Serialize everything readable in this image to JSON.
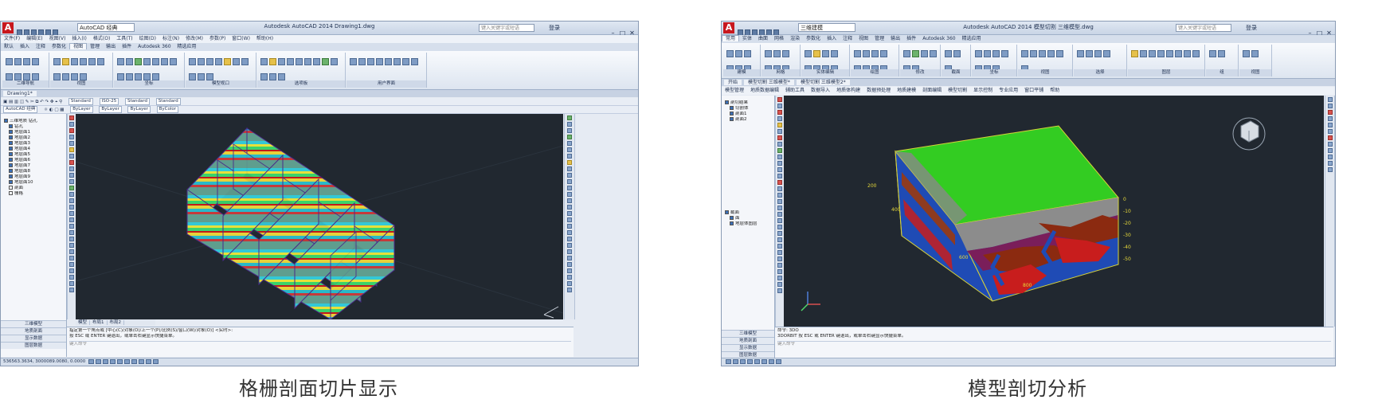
{
  "left": {
    "title": "Autodesk AutoCAD 2014  Drawing1.dwg",
    "workspace": "AutoCAD 经典",
    "search_placeholder": "键入关键字或短语",
    "login": "登录",
    "menus": [
      "文件(F)",
      "编辑(E)",
      "视图(V)",
      "插入(I)",
      "格式(O)",
      "工具(T)",
      "绘图(D)",
      "标注(N)",
      "修改(M)",
      "参数(P)",
      "窗口(W)",
      "帮助(H)"
    ],
    "ribbon_tabs": [
      "默认",
      "插入",
      "注释",
      "参数化",
      "视图",
      "管理",
      "输出",
      "插件",
      "Autodesk 360",
      "精选应用"
    ],
    "active_tab": "视图",
    "panels": [
      "二维导航",
      "视图",
      "坐标",
      "模型视口",
      "选项板",
      "用户界面"
    ],
    "doc_tab": "Drawing1*",
    "toolbar_styles": [
      "Standard",
      "ISO-25",
      "Standard",
      "Standard"
    ],
    "layer_bar": [
      "AutoCAD 经典",
      "ByLayer",
      "ByLayer",
      "ByLayer",
      "ByColor"
    ],
    "tree": [
      {
        "label": "三维地质 钻孔",
        "checked": true
      },
      {
        "label": "钻孔",
        "checked": true
      },
      {
        "label": "地层面1",
        "checked": true
      },
      {
        "label": "地层面2",
        "checked": true
      },
      {
        "label": "地层面3",
        "checked": true
      },
      {
        "label": "地层面4",
        "checked": true
      },
      {
        "label": "地层面5",
        "checked": true
      },
      {
        "label": "地层面6",
        "checked": true
      },
      {
        "label": "地层面7",
        "checked": true
      },
      {
        "label": "地层面8",
        "checked": true
      },
      {
        "label": "地层面9",
        "checked": true
      },
      {
        "label": "地层面10",
        "checked": true
      },
      {
        "label": "剖面",
        "checked": false
      },
      {
        "label": "栅格",
        "checked": false
      }
    ],
    "side_buttons": [
      "三维模型",
      "地质剖面",
      "显示数据",
      "图层数据"
    ],
    "layout_tabs": [
      "模型",
      "布局1",
      "布局2"
    ],
    "cmd_lines": [
      "指定第一个角点或 [中心(C)/对象(O)/上一个(P)/比例(S)/窗口(W)/对象(O)] <实时>:",
      "按 ESC 或 ENTER 键退出，或单击右键显示快捷菜单。"
    ],
    "cmd_prompt": "键入命令",
    "coords": "536563.3634, 3000089.0080, 0.0000",
    "caption": "格栅剖面切片显示"
  },
  "right": {
    "title": "Autodesk AutoCAD 2014  模型切割 三维模型.dwg",
    "workspace": "三维建模",
    "search_placeholder": "键入关键字或短语",
    "login": "登录",
    "ribbon_tabs": [
      "常用",
      "实体",
      "曲面",
      "网格",
      "渲染",
      "参数化",
      "插入",
      "注释",
      "视图",
      "管理",
      "输出",
      "插件",
      "Autodesk 360",
      "精选应用"
    ],
    "active_tab": "常用",
    "panels": [
      "建模",
      "网格",
      "实体编辑",
      "绘图",
      "修改",
      "截面",
      "坐标",
      "视图",
      "选择",
      "图层",
      "组",
      "视图"
    ],
    "doc_tabs": [
      "开始",
      "模型切割 三维模型*",
      "模型切割 三维模型2*"
    ],
    "menus": [
      "模型管理",
      "地质数据编辑",
      "辅助工具",
      "数据导入",
      "地质体构建",
      "数据预处理",
      "地质建模",
      "剖面编辑",
      "模型切割",
      "显示控制",
      "专业应用",
      "窗口平铺",
      "帮助"
    ],
    "tree_top": [
      {
        "label": "剖切结果",
        "checked": true
      },
      {
        "label": "切割体",
        "checked": true
      },
      {
        "label": "剖面1",
        "checked": true
      },
      {
        "label": "剖面2",
        "checked": true
      }
    ],
    "tree_bottom": [
      {
        "label": "截面",
        "checked": true
      },
      {
        "label": "面",
        "checked": true
      },
      {
        "label": "地层体图层",
        "checked": true
      }
    ],
    "side_buttons": [
      "三维模型",
      "地质剖面",
      "显示数据",
      "图层数据"
    ],
    "axis_labels": [
      "200",
      "400",
      "600",
      "800"
    ],
    "depth_labels": [
      "0",
      "-10",
      "-20",
      "-30",
      "-40",
      "-50"
    ],
    "cmd_lines": [
      "命令: 3DO",
      "3DORBIT 按 ESC 或 ENTER 键退出，或单击右键显示快捷菜单。"
    ],
    "cmd_prompt": "键入命令",
    "caption": "模型剖切分析"
  }
}
